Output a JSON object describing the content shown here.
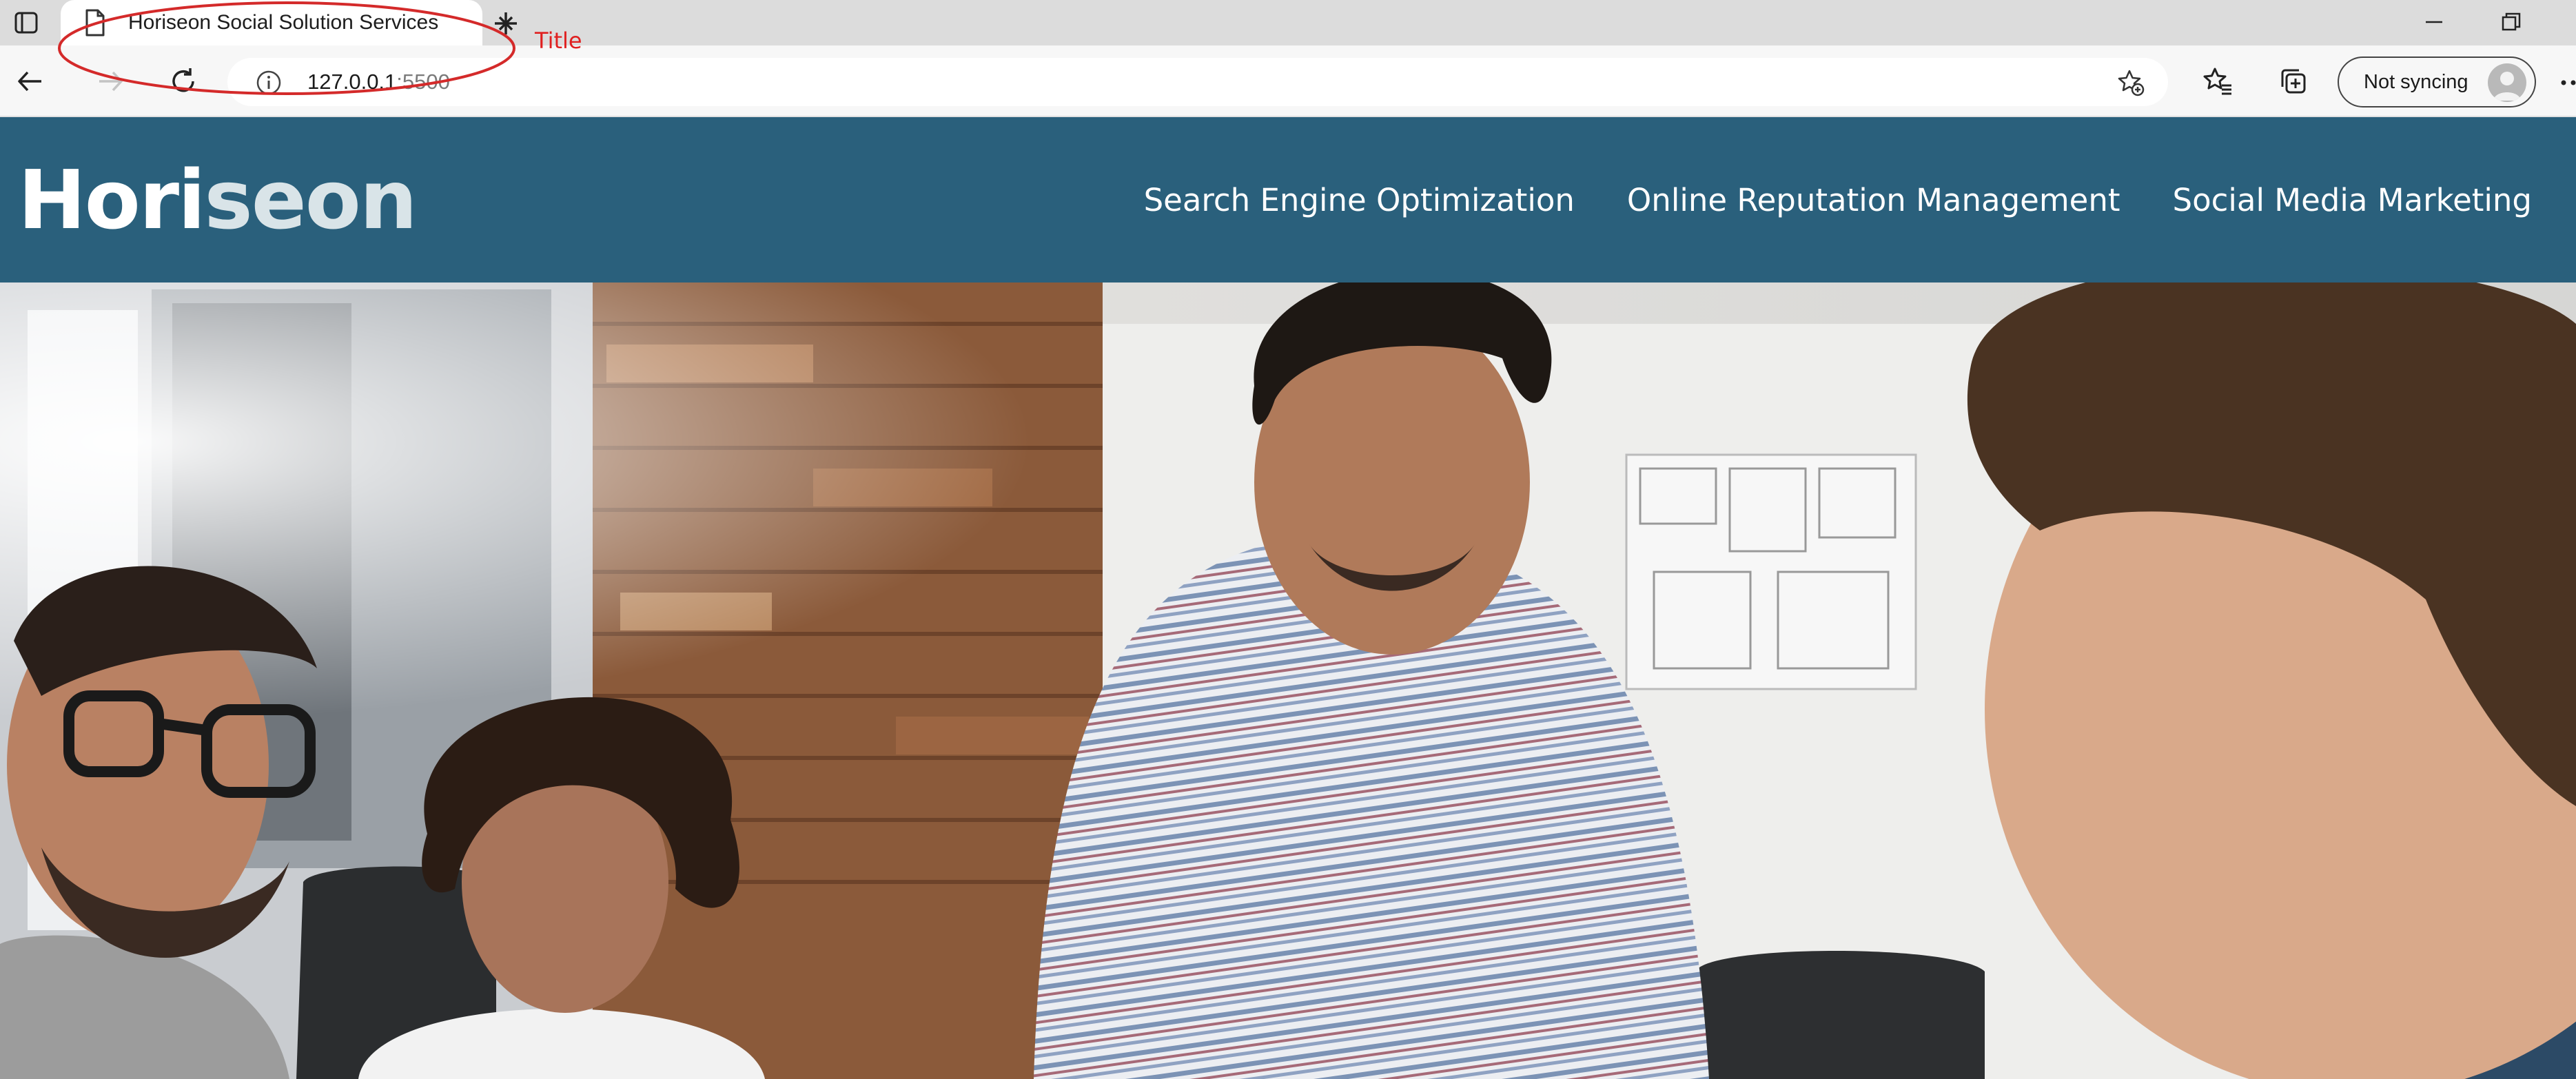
{
  "browser": {
    "tab_title": "Horiseon Social Solution Services",
    "address": {
      "host": "127.0.0.1",
      "port": ":5500"
    },
    "sync_label": "Not syncing"
  },
  "annotation": {
    "label": "Title",
    "color": "#e02020"
  },
  "site": {
    "logo_main": "Hori",
    "logo_accent": "seon",
    "header_color": "#2a607c",
    "nav": [
      {
        "label": "Search Engine Optimization"
      },
      {
        "label": "Online Reputation Management"
      },
      {
        "label": "Social Media Marketing"
      }
    ]
  }
}
